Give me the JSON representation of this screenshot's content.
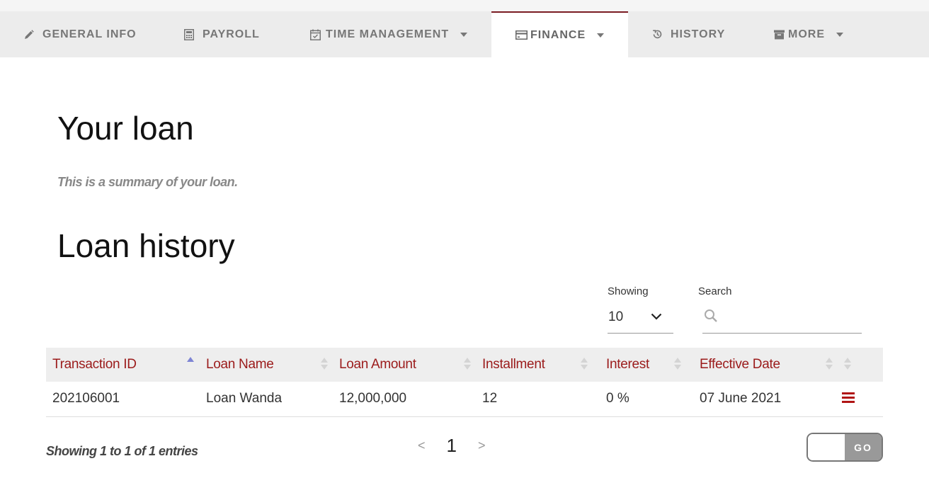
{
  "tabs": [
    {
      "label": "GENERAL INFO",
      "icon": "pencil-icon",
      "dropdown": false,
      "active": false
    },
    {
      "label": "PAYROLL",
      "icon": "calculator-icon",
      "dropdown": false,
      "active": false
    },
    {
      "label": "TIME MANAGEMENT",
      "icon": "calendar-check-icon",
      "dropdown": true,
      "active": false
    },
    {
      "label": "FINANCE",
      "icon": "credit-card-icon",
      "dropdown": true,
      "active": true
    },
    {
      "label": "HISTORY",
      "icon": "history-icon",
      "dropdown": false,
      "active": false
    },
    {
      "label": "MORE",
      "icon": "archive-icon",
      "dropdown": true,
      "active": false
    }
  ],
  "page": {
    "title": "Your loan",
    "subtitle": "This is a summary of your loan.",
    "section_title": "Loan history"
  },
  "controls": {
    "showing_label": "Showing",
    "page_size": "10",
    "search_label": "Search",
    "search_value": ""
  },
  "table": {
    "columns": [
      "Transaction ID",
      "Loan Name",
      "Loan Amount",
      "Installment",
      "Interest",
      "Effective Date"
    ],
    "rows": [
      {
        "transaction_id": "202106001",
        "loan_name": "Loan Wanda",
        "loan_amount": "12,000,000",
        "installment": "12",
        "interest": "0 %",
        "effective_date": "07 June 2021"
      }
    ]
  },
  "footer": {
    "entries_info": "Showing 1 to 1 of 1 entries",
    "prev": "<",
    "current_page": "1",
    "next": ">",
    "go_label": "GO",
    "goto_value": ""
  },
  "colors": {
    "accent": "#7b1c23",
    "header_text": "#9b1b1b",
    "sort_active": "#7d84d4",
    "menu_icon": "#b01515"
  }
}
